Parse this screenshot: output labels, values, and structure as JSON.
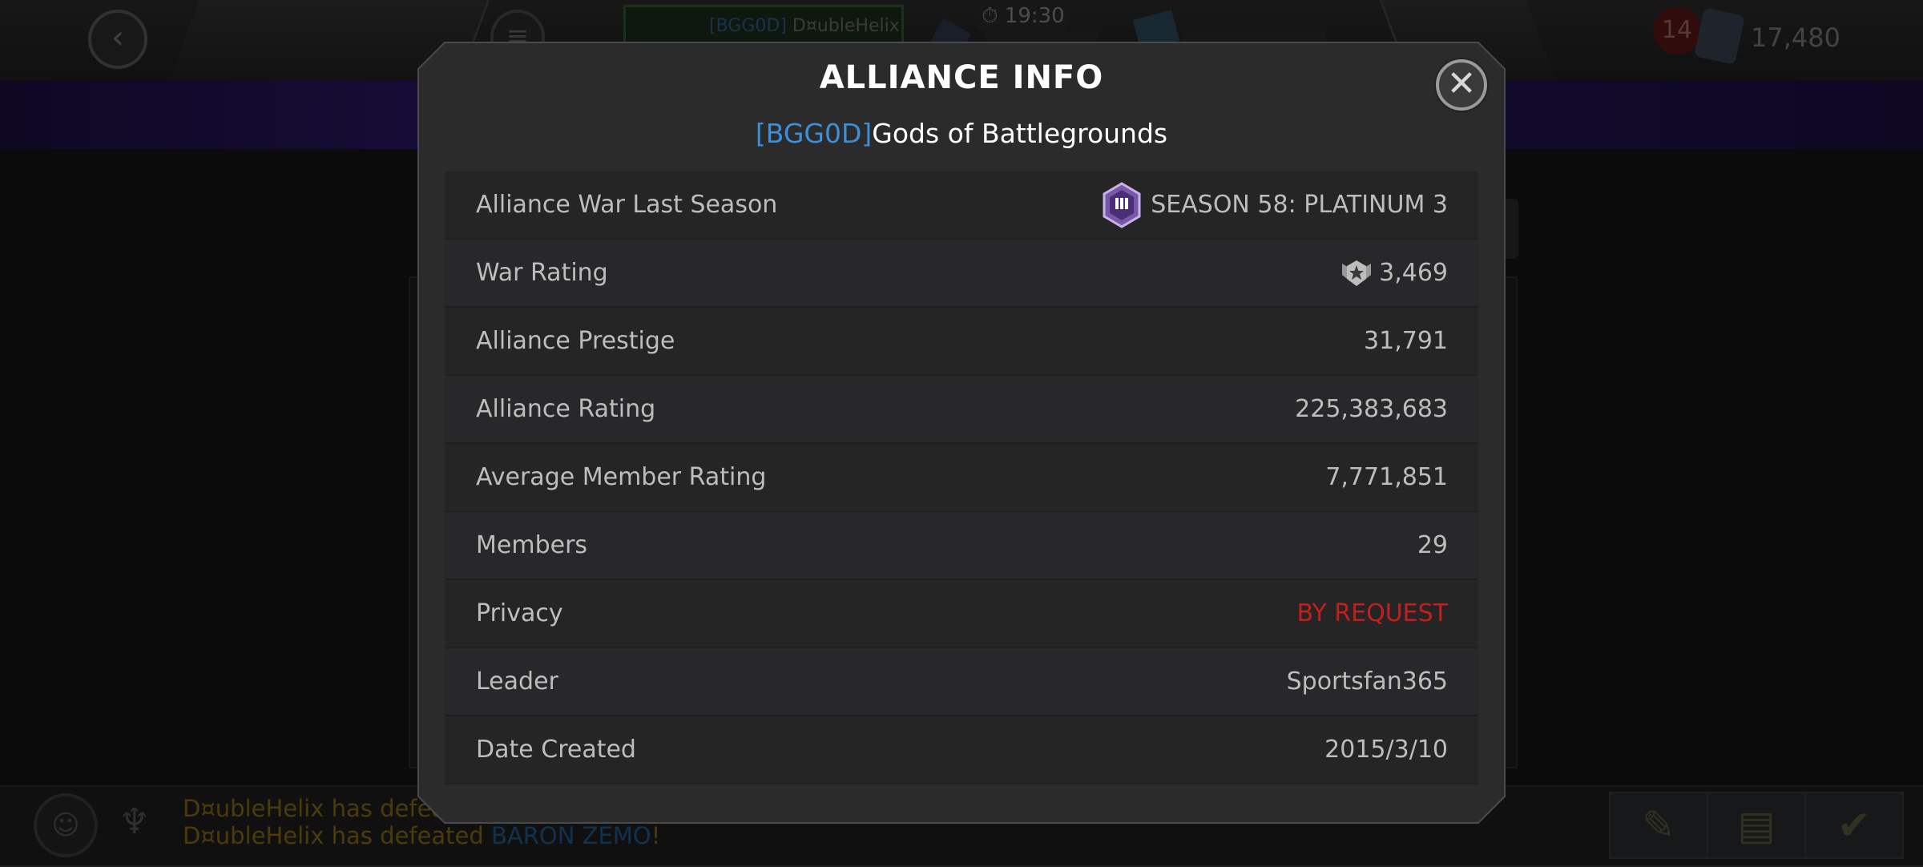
{
  "background": {
    "player_tag": "[BGG0D]",
    "player_name": "D¤ubleHelix",
    "timer": "19:30",
    "notification_count": "14",
    "gold_amount": "17,480",
    "news_lines": [
      {
        "prefix": "D¤ubleHelix has defeat",
        "hero": "",
        "suffix": ""
      },
      {
        "prefix": "D¤ubleHelix has defeated ",
        "hero": "BARON ZEMO",
        "suffix": "!"
      }
    ]
  },
  "modal": {
    "title": "ALLIANCE INFO",
    "alliance_tag": "[BGG0D]",
    "alliance_name": "Gods of Battlegrounds",
    "close_icon": "close-icon",
    "rows": [
      {
        "label": "Alliance War Last Season",
        "value": "SEASON 58: PLATINUM 3",
        "icon": "platinum-tier-icon"
      },
      {
        "label": "War Rating",
        "value": "3,469",
        "icon": "war-rating-icon"
      },
      {
        "label": "Alliance Prestige",
        "value": "31,791"
      },
      {
        "label": "Alliance Rating",
        "value": "225,383,683"
      },
      {
        "label": "Average Member Rating",
        "value": "7,771,851"
      },
      {
        "label": "Members",
        "value": "29"
      },
      {
        "label": "Privacy",
        "value": "BY REQUEST",
        "color": "#c41e1e"
      },
      {
        "label": "Leader",
        "value": "Sportsfan365"
      },
      {
        "label": "Date Created",
        "value": "2015/3/10"
      }
    ]
  },
  "colors": {
    "accent_blue": "#3d8fd8",
    "privacy_red": "#c41e1e",
    "news_gold": "#8a6a12"
  }
}
